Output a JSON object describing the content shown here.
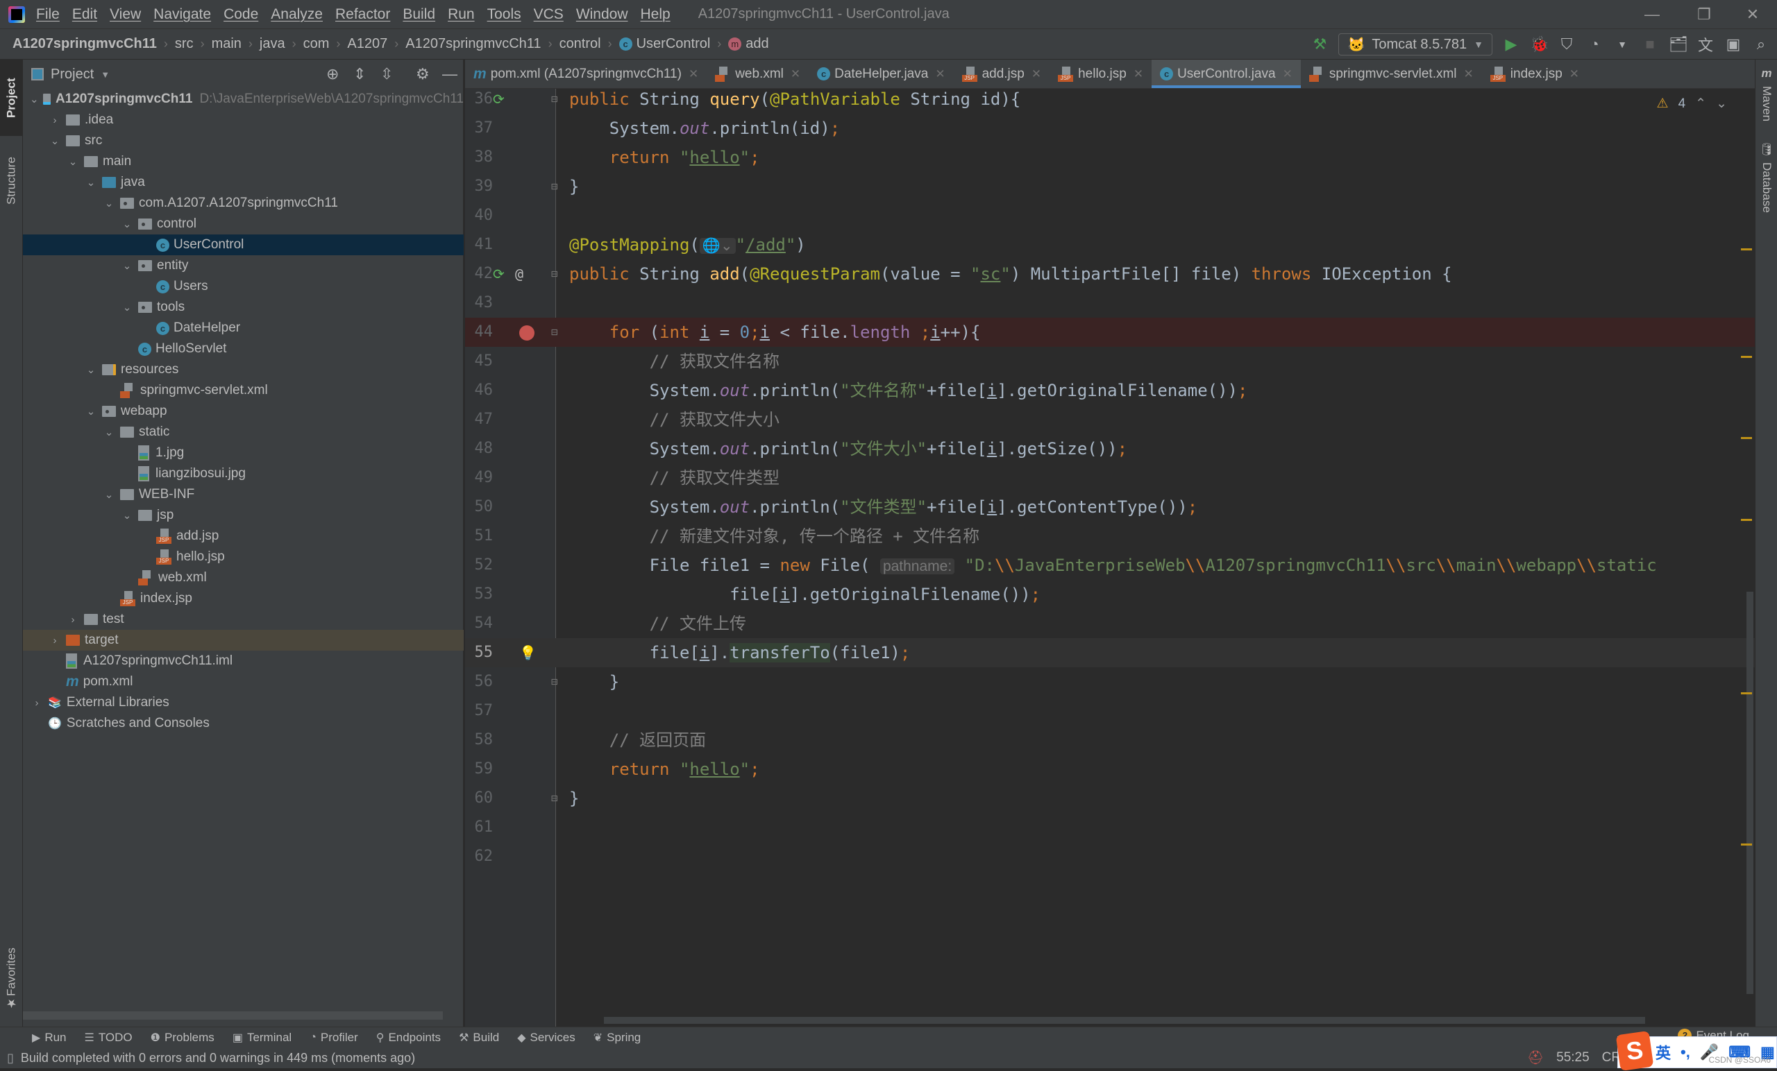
{
  "window": {
    "title": "A1207springmvcCh11 - UserControl.java",
    "controls": {
      "minimize": "—",
      "restore": "❐",
      "close": "✕"
    }
  },
  "menu": [
    "File",
    "Edit",
    "View",
    "Navigate",
    "Code",
    "Analyze",
    "Refactor",
    "Build",
    "Run",
    "Tools",
    "VCS",
    "Window",
    "Help"
  ],
  "breadcrumb": [
    "A1207springmvcCh11",
    "src",
    "main",
    "java",
    "com",
    "A1207",
    "A1207springmvcCh11",
    "control",
    "UserControl",
    "add"
  ],
  "run_toolbar": {
    "config": "Tomcat 8.5.781",
    "icons": [
      "build-hammer-icon",
      "run-icon",
      "debug-icon",
      "coverage-icon",
      "profile-icon",
      "stop-icon",
      "project-structure-icon",
      "translate-icon",
      "run-anything-icon",
      "search-icon"
    ]
  },
  "left_stripe": {
    "project": "Project",
    "structure": "Structure",
    "favorites": "Favorites"
  },
  "right_stripe": {
    "maven": "Maven",
    "database": "Database"
  },
  "project_panel": {
    "title": "Project",
    "tree": [
      {
        "label": "A1207springmvcCh11",
        "path": "D:\\JavaEnterpriseWeb\\A1207springmvcCh11",
        "depth": 0,
        "expanded": true,
        "icon": "module"
      },
      {
        "label": ".idea",
        "depth": 1,
        "expanded": false,
        "icon": "folder"
      },
      {
        "label": "src",
        "depth": 1,
        "expanded": true,
        "icon": "folder"
      },
      {
        "label": "main",
        "depth": 2,
        "expanded": true,
        "icon": "folder"
      },
      {
        "label": "java",
        "depth": 3,
        "expanded": true,
        "icon": "folder-blue"
      },
      {
        "label": "com.A1207.A1207springmvcCh11",
        "depth": 4,
        "expanded": true,
        "icon": "package"
      },
      {
        "label": "control",
        "depth": 5,
        "expanded": true,
        "icon": "package"
      },
      {
        "label": "UserControl",
        "depth": 6,
        "icon": "class",
        "selected": true
      },
      {
        "label": "entity",
        "depth": 5,
        "expanded": true,
        "icon": "package"
      },
      {
        "label": "Users",
        "depth": 6,
        "icon": "class"
      },
      {
        "label": "tools",
        "depth": 5,
        "expanded": true,
        "icon": "package"
      },
      {
        "label": "DateHelper",
        "depth": 6,
        "icon": "class"
      },
      {
        "label": "HelloServlet",
        "depth": 5,
        "icon": "class"
      },
      {
        "label": "resources",
        "depth": 3,
        "expanded": true,
        "icon": "folder-res"
      },
      {
        "label": "springmvc-servlet.xml",
        "depth": 4,
        "icon": "xml"
      },
      {
        "label": "webapp",
        "depth": 3,
        "expanded": true,
        "icon": "folder-web"
      },
      {
        "label": "static",
        "depth": 4,
        "expanded": true,
        "icon": "folder"
      },
      {
        "label": "1.jpg",
        "depth": 5,
        "icon": "image"
      },
      {
        "label": "liangzibosui.jpg",
        "depth": 5,
        "icon": "image"
      },
      {
        "label": "WEB-INF",
        "depth": 4,
        "expanded": true,
        "icon": "folder"
      },
      {
        "label": "jsp",
        "depth": 5,
        "expanded": true,
        "icon": "folder"
      },
      {
        "label": "add.jsp",
        "depth": 6,
        "icon": "jsp"
      },
      {
        "label": "hello.jsp",
        "depth": 6,
        "icon": "jsp"
      },
      {
        "label": "web.xml",
        "depth": 5,
        "icon": "xml"
      },
      {
        "label": "index.jsp",
        "depth": 4,
        "icon": "jsp"
      },
      {
        "label": "test",
        "depth": 2,
        "expanded": false,
        "icon": "folder"
      },
      {
        "label": "target",
        "depth": 1,
        "expanded": false,
        "icon": "folder-orange",
        "highlight": true
      },
      {
        "label": "A1207springmvcCh11.iml",
        "depth": 1,
        "icon": "iml"
      },
      {
        "label": "pom.xml",
        "depth": 1,
        "icon": "maven"
      },
      {
        "label": "External Libraries",
        "depth": 0,
        "expanded": false,
        "icon": "libraries"
      },
      {
        "label": "Scratches and Consoles",
        "depth": 0,
        "icon": "scratches"
      }
    ]
  },
  "editor_tabs": [
    {
      "label": "pom.xml (A1207springmvcCh11)",
      "icon": "maven"
    },
    {
      "label": "web.xml",
      "icon": "xml"
    },
    {
      "label": "DateHelper.java",
      "icon": "class"
    },
    {
      "label": "add.jsp",
      "icon": "jsp"
    },
    {
      "label": "hello.jsp",
      "icon": "jsp"
    },
    {
      "label": "UserControl.java",
      "icon": "class",
      "active": true
    },
    {
      "label": "springmvc-servlet.xml",
      "icon": "xml"
    },
    {
      "label": "index.jsp",
      "icon": "jsp"
    }
  ],
  "editor": {
    "warnings": "4",
    "caret": "55:25",
    "line_numbers": [
      "36",
      "37",
      "38",
      "39",
      "40",
      "41",
      "42",
      "43",
      "44",
      "45",
      "46",
      "47",
      "48",
      "49",
      "50",
      "51",
      "52",
      "53",
      "54",
      "55",
      "56",
      "57",
      "58",
      "59",
      "60",
      "61",
      "62"
    ],
    "breakpoint_line": "44",
    "current_line": "55",
    "lines": {
      "l36": [
        [
          "kw",
          "public "
        ],
        [
          "pl",
          "String "
        ],
        [
          "fn",
          "query"
        ],
        [
          "pl",
          "("
        ],
        [
          "ann",
          "@PathVariable "
        ],
        [
          "pl",
          "String id){"
        ]
      ],
      "l37": [
        [
          "pl",
          "    System."
        ],
        [
          "fld",
          "out"
        ],
        [
          "pl",
          ".println(id)"
        ],
        [
          "kw",
          ";"
        ]
      ],
      "l38": [
        [
          "kw",
          "    return "
        ],
        [
          "str",
          "\""
        ],
        [
          "str ul",
          "hello"
        ],
        [
          "str",
          "\""
        ],
        [
          "kw",
          ";"
        ]
      ],
      "l39": [
        [
          "pl",
          "}"
        ]
      ],
      "l40": [],
      "l41": [
        [
          "ann",
          "@PostMapping"
        ],
        [
          "pl",
          "("
        ],
        [
          "hint",
          "🌐⌄"
        ],
        [
          "str",
          "\""
        ],
        [
          "str ul",
          "/add"
        ],
        [
          "str",
          "\""
        ],
        [
          "pl",
          ")"
        ]
      ],
      "l42": [
        [
          "kw",
          "public "
        ],
        [
          "pl",
          "String "
        ],
        [
          "fn",
          "add"
        ],
        [
          "pl",
          "("
        ],
        [
          "ann",
          "@RequestParam"
        ],
        [
          "pl",
          "(value = "
        ],
        [
          "str",
          "\""
        ],
        [
          "str ul",
          "sc"
        ],
        [
          "str",
          "\""
        ],
        [
          "pl",
          ") MultipartFile[] file) "
        ],
        [
          "kw",
          "throws "
        ],
        [
          "pl",
          "IOException {"
        ]
      ],
      "l43": [],
      "l44": [
        [
          "kw",
          "    for "
        ],
        [
          "pl",
          "("
        ],
        [
          "kw",
          "int "
        ],
        [
          "pl ul",
          "i"
        ],
        [
          "pl",
          " = "
        ],
        [
          "num",
          "0"
        ],
        [
          "kw",
          ";"
        ],
        [
          "pl ul",
          "i"
        ],
        [
          "pl",
          " < file."
        ],
        [
          "fld2",
          "length "
        ],
        [
          "kw",
          ";"
        ],
        [
          "pl ul",
          "i"
        ],
        [
          "pl",
          "++){"
        ]
      ],
      "l45": [
        [
          "cmt",
          "        // 获取文件名称"
        ]
      ],
      "l46": [
        [
          "pl",
          "        System."
        ],
        [
          "fld",
          "out"
        ],
        [
          "pl",
          ".println("
        ],
        [
          "str",
          "\"文件名称\""
        ],
        [
          "pl",
          "+file["
        ],
        [
          "pl ul",
          "i"
        ],
        [
          "pl",
          "].getOriginalFilename())"
        ],
        [
          "kw",
          ";"
        ]
      ],
      "l47": [
        [
          "cmt",
          "        // 获取文件大小"
        ]
      ],
      "l48": [
        [
          "pl",
          "        System."
        ],
        [
          "fld",
          "out"
        ],
        [
          "pl",
          ".println("
        ],
        [
          "str",
          "\"文件大小\""
        ],
        [
          "pl",
          "+file["
        ],
        [
          "pl ul",
          "i"
        ],
        [
          "pl",
          "].getSize())"
        ],
        [
          "kw",
          ";"
        ]
      ],
      "l49": [
        [
          "cmt",
          "        // 获取文件类型"
        ]
      ],
      "l50": [
        [
          "pl",
          "        System."
        ],
        [
          "fld",
          "out"
        ],
        [
          "pl",
          ".println("
        ],
        [
          "str",
          "\"文件类型\""
        ],
        [
          "pl",
          "+file["
        ],
        [
          "pl ul",
          "i"
        ],
        [
          "pl",
          "].getContentType())"
        ],
        [
          "kw",
          ";"
        ]
      ],
      "l51": [
        [
          "cmt",
          "        // 新建文件对象, 传一个路径 + 文件名称"
        ]
      ],
      "l52": [
        [
          "pl",
          "        File file1 = "
        ],
        [
          "kw",
          "new "
        ],
        [
          "pl",
          "File( "
        ],
        [
          "hint",
          "pathname:"
        ],
        [
          "pl",
          " "
        ],
        [
          "str",
          "\"D:"
        ],
        [
          "esc",
          "\\\\"
        ],
        [
          "str",
          "JavaEnterpriseWeb"
        ],
        [
          "esc",
          "\\\\"
        ],
        [
          "str",
          "A1207springmvcCh11"
        ],
        [
          "esc",
          "\\\\"
        ],
        [
          "str",
          "src"
        ],
        [
          "esc",
          "\\\\"
        ],
        [
          "str",
          "main"
        ],
        [
          "esc",
          "\\\\"
        ],
        [
          "str",
          "webapp"
        ],
        [
          "esc",
          "\\\\"
        ],
        [
          "str",
          "static"
        ]
      ],
      "l53": [
        [
          "pl",
          "                file["
        ],
        [
          "pl ul",
          "i"
        ],
        [
          "pl",
          "].getOriginalFilename())"
        ],
        [
          "kw",
          ";"
        ]
      ],
      "l54": [
        [
          "cmt",
          "        // 文件上传"
        ]
      ],
      "l55": [
        [
          "pl",
          "        file["
        ],
        [
          "pl ul",
          "i"
        ],
        [
          "pl",
          "]."
        ],
        [
          "pl",
          "transferTo"
        ],
        [
          "pl",
          "(file1)"
        ],
        [
          "kw",
          ";"
        ]
      ],
      "l56": [
        [
          "pl",
          "    }"
        ]
      ],
      "l57": [],
      "l58": [
        [
          "cmt",
          "    // 返回页面"
        ]
      ],
      "l59": [
        [
          "kw",
          "    return "
        ],
        [
          "str",
          "\""
        ],
        [
          "str ul",
          "hello"
        ],
        [
          "str",
          "\""
        ],
        [
          "kw",
          ";"
        ]
      ],
      "l60": [
        [
          "pl",
          "}"
        ]
      ],
      "l61": [],
      "l62": []
    }
  },
  "bottom_tools": [
    {
      "label": "Run",
      "icon": "▶"
    },
    {
      "label": "TODO",
      "icon": "☰"
    },
    {
      "label": "Problems",
      "icon": "❶"
    },
    {
      "label": "Terminal",
      "icon": "▣"
    },
    {
      "label": "Profiler",
      "icon": "◔"
    },
    {
      "label": "Endpoints",
      "icon": "⚲"
    },
    {
      "label": "Build",
      "icon": "⚒"
    },
    {
      "label": "Services",
      "icon": "◆"
    },
    {
      "label": "Spring",
      "icon": "❦"
    }
  ],
  "event_log": {
    "count": "2",
    "label": "Event Log"
  },
  "status": {
    "message": "Build completed with 0 errors and 0 warnings in 449 ms (moments ago)",
    "position": "55:25",
    "line_sep": "CRLF"
  },
  "ime": {
    "logo": "S",
    "lang": "英",
    "punct": "•,",
    "mic": "🎤",
    "keyboard": "⌨",
    "apps": "▦",
    "watermark": "CSDN @SSOA6"
  }
}
